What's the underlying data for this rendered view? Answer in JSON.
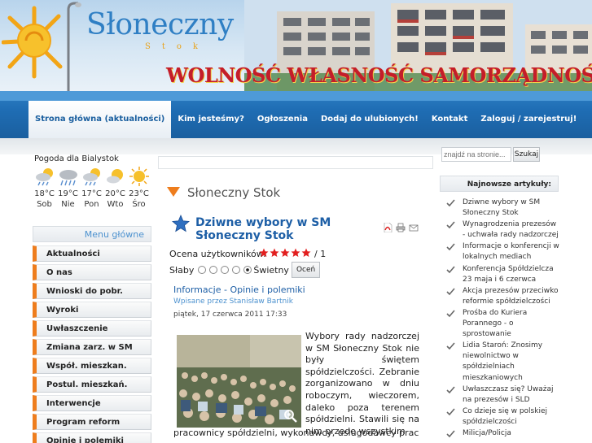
{
  "header": {
    "logo_text": "Słoneczny",
    "logo_sub": "Stok",
    "motto": "WOLNOŚĆ  WŁASNOŚĆ  SAMORZĄDNOŚĆ"
  },
  "nav": {
    "items": [
      {
        "label": "Strona główna (aktualności)",
        "active": true
      },
      {
        "label": "Kim jesteśmy?"
      },
      {
        "label": "Ogłoszenia"
      },
      {
        "label": "Dodaj do ulubionych!"
      },
      {
        "label": "Kontakt"
      },
      {
        "label": "Zaloguj / zarejestruj!"
      }
    ]
  },
  "weather": {
    "title": "Pogoda dla Bialystok",
    "days": [
      {
        "temp": "18°C",
        "day": "Sob",
        "icon": "partly-cloudy-rain-icon"
      },
      {
        "temp": "19°C",
        "day": "Nie",
        "icon": "rain-cloud-icon"
      },
      {
        "temp": "17°C",
        "day": "Pon",
        "icon": "partly-cloudy-rain-icon"
      },
      {
        "temp": "20°C",
        "day": "Wto",
        "icon": "partly-cloudy-icon"
      },
      {
        "temp": "23°C",
        "day": "Śro",
        "icon": "sun-icon"
      }
    ]
  },
  "main_menu": {
    "title": "Menu główne",
    "items": [
      "Aktualności",
      "O nas",
      "Wnioski do pobr.",
      "Wyroki",
      "Uwłaszczenie",
      "Zmiana zarz. w SM",
      "Współ. mieszkan.",
      "Postul. mieszkań.",
      "Interwencje",
      "Program reform",
      "Opinie i polemiki"
    ]
  },
  "content": {
    "section_title": "Słoneczny Stok",
    "article_title": "Dziwne wybory w SM Słoneczny Stok",
    "rating_label": "Ocena użytkowników:",
    "rating_count": "/ 1",
    "rating_value": 5,
    "vote_low": "Słaby",
    "vote_high": "Świetny",
    "vote_button": "Oceń",
    "category": "Informacje - Opinie i polemiki",
    "author": "Wpisane przez Stanisław Bartnik",
    "date": "piątek, 17 czerwca 2011 17:33",
    "body": "Wybory rady nadzorczej w SM Słoneczny Stok nie były świętem spółdzielczości. Zebranie zorganizowano w dniu roboczym, wieczorem, daleko poza terenem spółdzielni. Stawili się na nim przede wszystkim",
    "body_cont": "pracownicy spółdzielni, wykonawcy, usługodawcy pracujący"
  },
  "search": {
    "placeholder": "znajdź na stronie...",
    "button": "Szukaj"
  },
  "latest": {
    "title": "Najnowsze artykuły:",
    "items": [
      "Dziwne wybory w SM Słoneczny Stok",
      "Wynagrodzenia prezesów - uchwała rady nadzorczej",
      "Informacje o konferencji w lokalnych mediach",
      "Konferencja Spółdzielcza 23 maja i 6 czerwca",
      "Akcja prezesów przeciwko reformie spółdzielczości",
      "Prośba do Kuriera Porannego - o sprostowanie",
      "Lidia Staroń: Znosimy niewolnictwo w spółdzielniach mieszkaniowych",
      "Uwłaszczasz się? Uważaj na prezesów i SLD",
      "Co dzieje się w polskiej spółdzielczości",
      "Milicja/Policja"
    ]
  },
  "colors": {
    "brand_blue": "#1f6db4",
    "accent_orange": "#ee7d1d",
    "motto_red": "#c41d2a",
    "link_blue": "#1e5fa6"
  }
}
